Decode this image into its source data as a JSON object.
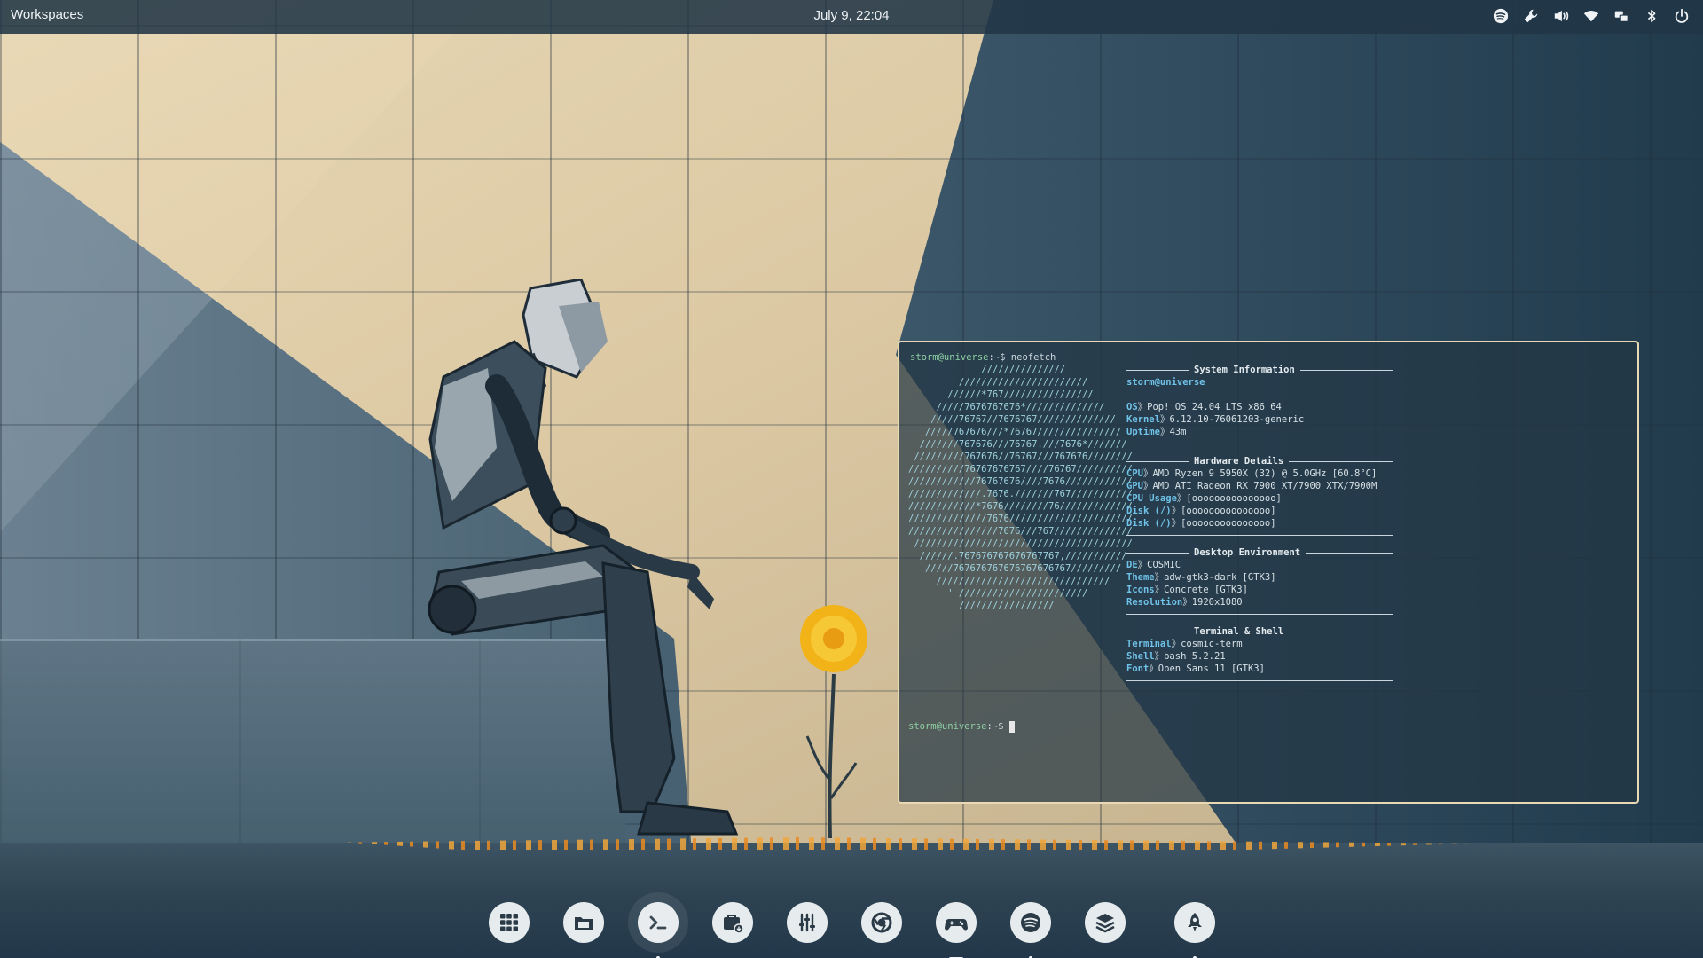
{
  "top_panel": {
    "workspaces_label": "Workspaces",
    "clock": "July 9, 22:04",
    "tray_icons": [
      "spotify-icon",
      "wrench-icon",
      "volume-icon",
      "wifi-icon",
      "network-icon",
      "bluetooth-icon",
      "power-icon"
    ]
  },
  "terminal": {
    "prompt_user": "storm@universe",
    "prompt_suffix": ":~$",
    "command": " neofetch",
    "ascii_logo": "             ///////////////\n         ///////////////////////\n       //////*767////////////////\n     /////7676767676*//////////////\n    /////76767//7676767//////////////\n   /////767676///*76767///////////////\n  ///////767676///76767.///7676*///////\n /////////767676//76767///767676////////\n//////////76767676767////76767//////////\n////////////76767676////7676////////////\n/////////////.7676.///////767///////////\n////////////*7676////////76/////////////\n//////////////7676//////////////////////\n////////////////7676///767//////////////\n ///////////////////////////////////////\n  //////.767676767676767767,///////////\n   /////767676767676767676767/////////\n     ///////////////////////////////\n       ' ///////////////////////\n         /////////////////",
    "system_information": {
      "header": "System Information",
      "user_host": "storm@universe",
      "rows": [
        {
          "key": "OS",
          "value": "Pop!_OS 24.04 LTS x86_64"
        },
        {
          "key": "Kernel",
          "value": "6.12.10-76061203-generic"
        },
        {
          "key": "Uptime",
          "value": "43m"
        }
      ]
    },
    "hardware_details": {
      "header": "Hardware Details",
      "rows": [
        {
          "key": "CPU",
          "value": "AMD Ryzen 9 5950X (32) @ 5.0GHz [60.8°C]"
        },
        {
          "key": "GPU",
          "value": "AMD ATI Radeon RX 7900 XT/7900 XTX/7900M"
        },
        {
          "key": "CPU Usage",
          "value": "[ooooooooooooooo]"
        },
        {
          "key": "Disk (/)",
          "value": "[ooooooooooooooo]"
        },
        {
          "key": "Disk (/)",
          "value": "[ooooooooooooooo]"
        }
      ]
    },
    "desktop_environment": {
      "header": "Desktop Environment",
      "rows": [
        {
          "key": "DE",
          "value": "COSMIC"
        },
        {
          "key": "Theme",
          "value": "adw-gtk3-dark [GTK3]"
        },
        {
          "key": "Icons",
          "value": "Concrete [GTK3]"
        },
        {
          "key": "Resolution",
          "value": "1920x1080"
        }
      ]
    },
    "terminal_shell": {
      "header": "Terminal & Shell",
      "rows": [
        {
          "key": "Terminal",
          "value": "cosmic-term"
        },
        {
          "key": "Shell",
          "value": "bash 5.2.21"
        },
        {
          "key": "Font",
          "value": "Open Sans 11 [GTK3]"
        }
      ]
    },
    "separator": "》"
  },
  "dock": {
    "items": [
      {
        "name": "app-grid",
        "icon": "grid-icon",
        "indicator": "none"
      },
      {
        "name": "files",
        "icon": "folder-icon",
        "indicator": "none"
      },
      {
        "name": "terminal",
        "icon": "terminal-icon",
        "indicator": "dot"
      },
      {
        "name": "store",
        "icon": "store-icon",
        "indicator": "none"
      },
      {
        "name": "mixer",
        "icon": "sliders-icon",
        "indicator": "none"
      },
      {
        "name": "chrome",
        "icon": "chrome-icon",
        "indicator": "none"
      },
      {
        "name": "games",
        "icon": "gamepad-icon",
        "indicator": "bar"
      },
      {
        "name": "spotify",
        "icon": "spotify-icon",
        "indicator": "dot"
      },
      {
        "name": "layers",
        "icon": "layers-icon",
        "indicator": "none"
      },
      {
        "name": "launcher",
        "icon": "rocket-icon",
        "indicator": "dot"
      }
    ]
  },
  "colors": {
    "panel_bg": "#213546",
    "terminal_border": "#e8d9b4",
    "key_color": "#6fc2e8",
    "prompt_color": "#8fd0a3"
  }
}
